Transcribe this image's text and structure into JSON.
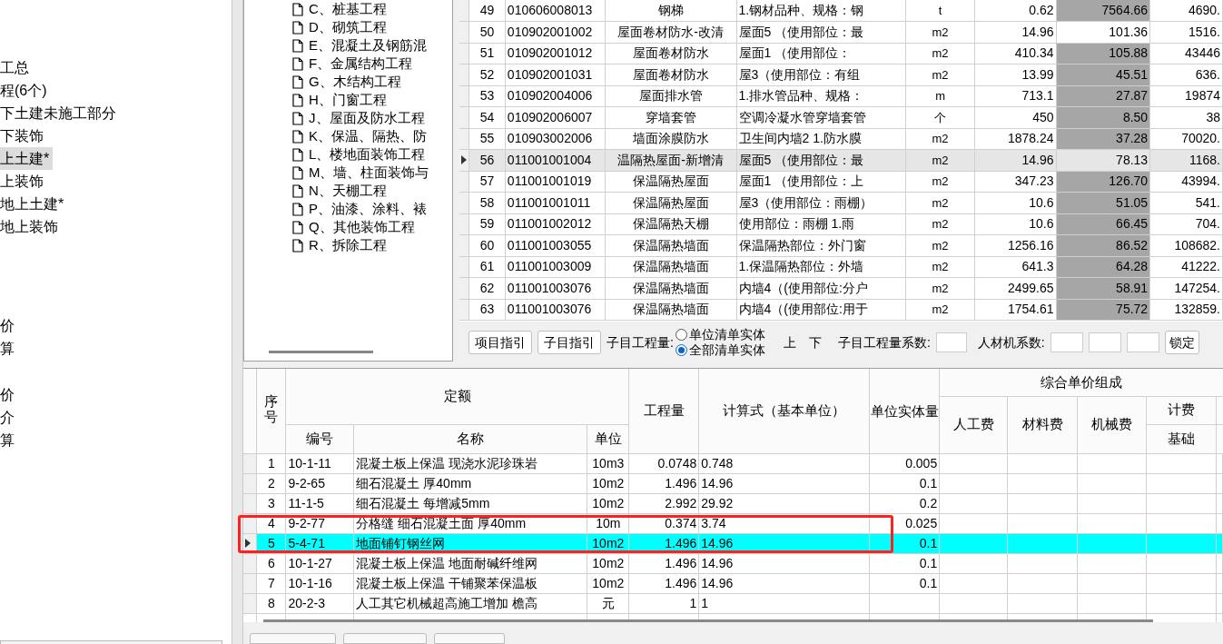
{
  "project_tree": {
    "items": [
      {
        "label": "工总",
        "selected": false
      },
      {
        "label": "程(6个)",
        "selected": false
      },
      {
        "label": "下土建未施工部分",
        "selected": false
      },
      {
        "label": "下装饰",
        "selected": false
      },
      {
        "label": "上土建*",
        "selected": true
      },
      {
        "label": "上装饰",
        "selected": false
      },
      {
        "label": "地上土建*",
        "selected": false
      },
      {
        "label": "地上装饰",
        "selected": false
      }
    ],
    "lower_items": [
      "价",
      "算",
      "价",
      "介",
      "算"
    ]
  },
  "category_tree": {
    "items": [
      "C、桩基工程",
      "D、砌筑工程",
      "E、混凝土及钢筋混",
      "F、金属结构工程",
      "G、木结构工程",
      "H、门窗工程",
      "J、屋面及防水工程",
      "K、保温、隔热、防",
      "L、楼地面装饰工程",
      "M、墙、柱面装饰与",
      "N、天棚工程",
      "P、油漆、涂料、裱",
      "Q、其他装饰工程",
      "R、拆除工程"
    ]
  },
  "bill_table": {
    "rows": [
      {
        "seq": "49",
        "code": "010606008013",
        "name": "钢梯",
        "description": "1.钢材品种、规格：钢",
        "unit": "t",
        "quantity": "0.62",
        "unit_price": "7564.66",
        "total": "4690.",
        "shaded": true,
        "selected": false
      },
      {
        "seq": "50",
        "code": "010902001002",
        "name": "屋面卷材防水-改清",
        "description": "屋面5 （使用部位：最",
        "unit": "m2",
        "quantity": "14.96",
        "unit_price": "101.36",
        "total": "1516.",
        "shaded": false,
        "selected": false
      },
      {
        "seq": "51",
        "code": "010902001012",
        "name": "屋面卷材防水",
        "description": "屋面1 （使用部位：",
        "unit": "m2",
        "quantity": "410.34",
        "unit_price": "105.88",
        "total": "43446",
        "shaded": true,
        "selected": false
      },
      {
        "seq": "52",
        "code": "010902001031",
        "name": "屋面卷材防水",
        "description": "屋3（使用部位：有组",
        "unit": "m2",
        "quantity": "13.99",
        "unit_price": "45.51",
        "total": "636.",
        "shaded": true,
        "selected": false
      },
      {
        "seq": "53",
        "code": "010902004006",
        "name": "屋面排水管",
        "description": "1.排水管品种、规格：",
        "unit": "m",
        "quantity": "713.1",
        "unit_price": "27.87",
        "total": "19874",
        "shaded": true,
        "selected": false
      },
      {
        "seq": "54",
        "code": "010902006007",
        "name": "穿墙套管",
        "description": "空调冷凝水管穿墙套管",
        "unit": "个",
        "quantity": "450",
        "unit_price": "8.50",
        "total": "38",
        "shaded": true,
        "selected": false
      },
      {
        "seq": "55",
        "code": "010903002006",
        "name": "墙面涂膜防水",
        "description": "卫生间内墙2 1.防水膜",
        "unit": "m2",
        "quantity": "1878.24",
        "unit_price": "37.28",
        "total": "70020.",
        "shaded": true,
        "selected": false
      },
      {
        "seq": "56",
        "code": "011001001004",
        "name": "温隔热屋面-新增清",
        "description": "屋面5 （使用部位：最",
        "unit": "m2",
        "quantity": "14.96",
        "unit_price": "78.13",
        "total": "1168.",
        "shaded": false,
        "selected": true
      },
      {
        "seq": "57",
        "code": "011001001019",
        "name": "保温隔热屋面",
        "description": "屋面1 （使用部位：上",
        "unit": "m2",
        "quantity": "347.23",
        "unit_price": "126.70",
        "total": "43994.",
        "shaded": true,
        "selected": false
      },
      {
        "seq": "58",
        "code": "011001001011",
        "name": "保温隔热屋面",
        "description": "屋3（使用部位：雨棚）",
        "unit": "m2",
        "quantity": "10.6",
        "unit_price": "51.05",
        "total": "541.",
        "shaded": true,
        "selected": false
      },
      {
        "seq": "59",
        "code": "011001002012",
        "name": "保温隔热天棚",
        "description": "使用部位：雨棚 1.雨",
        "unit": "m2",
        "quantity": "10.6",
        "unit_price": "66.45",
        "total": "704.",
        "shaded": true,
        "selected": false
      },
      {
        "seq": "60",
        "code": "011001003055",
        "name": "保温隔热墙面",
        "description": "保温隔热部位：外门窗",
        "unit": "m2",
        "quantity": "1256.16",
        "unit_price": "86.52",
        "total": "108682.",
        "shaded": true,
        "selected": false
      },
      {
        "seq": "61",
        "code": "011001003009",
        "name": "保温隔热墙面",
        "description": "1.保温隔热部位：外墙",
        "unit": "m2",
        "quantity": "641.3",
        "unit_price": "64.28",
        "total": "41222.",
        "shaded": true,
        "selected": false
      },
      {
        "seq": "62",
        "code": "011001003076",
        "name": "保温隔热墙面",
        "description": "内墙4（(使用部位:分户",
        "unit": "m2",
        "quantity": "2499.65",
        "unit_price": "58.91",
        "total": "147254.",
        "shaded": true,
        "selected": false
      },
      {
        "seq": "63",
        "code": "011001003076",
        "name": "保温隔热墙面",
        "description": "内墙4（(使用部位:用于",
        "unit": "m2",
        "quantity": "1754.61",
        "unit_price": "75.72",
        "total": "132859.",
        "shaded": true,
        "selected": false
      }
    ]
  },
  "toolbar": {
    "buttons": [
      "项目指引",
      "子目指引"
    ],
    "quantity_label": "子目工程量:",
    "radios": [
      {
        "label": "单位清单实体",
        "selected": false
      },
      {
        "label": "全部清单实体",
        "selected": true
      }
    ],
    "up": "上",
    "down": "下",
    "coefficient_label": "子目工程量系数:",
    "material_label": "人材机系数:",
    "lock_button": "锁定"
  },
  "quota_table": {
    "headers": {
      "seq": "序号",
      "quota": "定额",
      "code": "编号",
      "name": "名称",
      "unit": "单位",
      "quantity": "工程量",
      "formula": "计算式（基本单位）",
      "entity": "单位实体量",
      "composition": "综合单价组成",
      "labor": "人工费",
      "material": "材料费",
      "machine": "机械费",
      "base_top": "计费",
      "base_bottom": "基础"
    },
    "rows": [
      {
        "seq": "1",
        "code": "10-1-11",
        "name": "混凝土板上保温 现浇水泥珍珠岩",
        "unit": "10m3",
        "quantity": "0.0748",
        "formula": "0.748",
        "entity": "0.005",
        "selected": false
      },
      {
        "seq": "2",
        "code": "9-2-65",
        "name": "细石混凝土 厚40mm",
        "unit": "10m2",
        "quantity": "1.496",
        "formula": "14.96",
        "entity": "0.1",
        "selected": false
      },
      {
        "seq": "3",
        "code": "11-1-5",
        "name": "细石混凝土 每增减5mm",
        "unit": "10m2",
        "quantity": "2.992",
        "formula": "29.92",
        "entity": "0.2",
        "selected": false
      },
      {
        "seq": "4",
        "code": "9-2-77",
        "name": "分格缝 细石混凝土面 厚40mm",
        "unit": "10m",
        "quantity": "0.374",
        "formula": "3.74",
        "entity": "0.025",
        "selected": false
      },
      {
        "seq": "5",
        "code": "5-4-71",
        "name": "地面铺钉钢丝网",
        "unit": "10m2",
        "quantity": "1.496",
        "formula": "14.96",
        "entity": "0.1",
        "selected": true
      },
      {
        "seq": "6",
        "code": "10-1-27",
        "name": "混凝土板上保温 地面耐碱纤维网",
        "unit": "10m2",
        "quantity": "1.496",
        "formula": "14.96",
        "entity": "0.1",
        "selected": false
      },
      {
        "seq": "7",
        "code": "10-1-16",
        "name": "混凝土板上保温 干铺聚苯保温板",
        "unit": "10m2",
        "quantity": "1.496",
        "formula": "14.96",
        "entity": "0.1",
        "selected": false
      },
      {
        "seq": "8",
        "code": "20-2-3",
        "name": "人工其它机械超高施工增加 檐高",
        "unit": "元",
        "quantity": "1",
        "formula": "1",
        "entity": "",
        "selected": false
      }
    ]
  }
}
